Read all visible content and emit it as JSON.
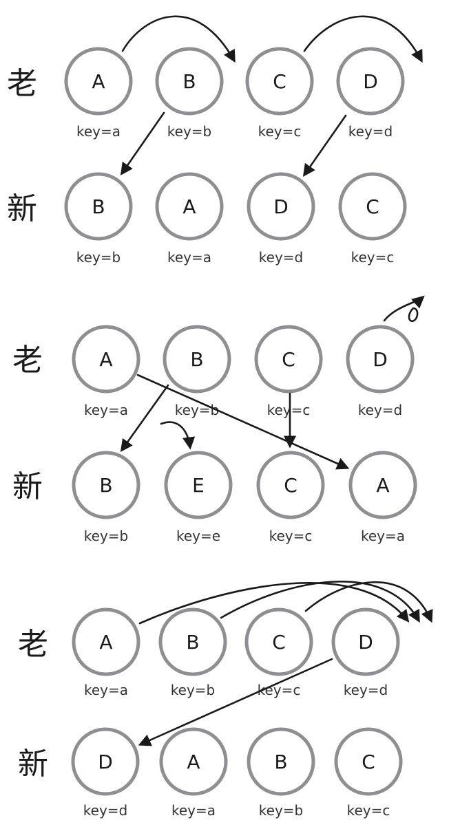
{
  "diagrams": [
    {
      "old_label": "老",
      "new_label": "新",
      "old": [
        {
          "letter": "A",
          "key": "key=a"
        },
        {
          "letter": "B",
          "key": "key=b"
        },
        {
          "letter": "C",
          "key": "key=c"
        },
        {
          "letter": "D",
          "key": "key=d"
        }
      ],
      "new": [
        {
          "letter": "B",
          "key": "key=b"
        },
        {
          "letter": "A",
          "key": "key=a"
        },
        {
          "letter": "D",
          "key": "key=d"
        },
        {
          "letter": "C",
          "key": "key=c"
        }
      ]
    },
    {
      "old_label": "老",
      "new_label": "新",
      "old": [
        {
          "letter": "A",
          "key": "key=a"
        },
        {
          "letter": "B",
          "key": "key=b"
        },
        {
          "letter": "C",
          "key": "key=c"
        },
        {
          "letter": "D",
          "key": "key=d"
        }
      ],
      "new": [
        {
          "letter": "B",
          "key": "key=b"
        },
        {
          "letter": "E",
          "key": "key=e"
        },
        {
          "letter": "C",
          "key": "key=c"
        },
        {
          "letter": "A",
          "key": "key=a"
        }
      ]
    },
    {
      "old_label": "老",
      "new_label": "新",
      "old": [
        {
          "letter": "A",
          "key": "key=a"
        },
        {
          "letter": "B",
          "key": "key=b"
        },
        {
          "letter": "C",
          "key": "key=c"
        },
        {
          "letter": "D",
          "key": "key=d"
        }
      ],
      "new": [
        {
          "letter": "D",
          "key": "key=d"
        },
        {
          "letter": "A",
          "key": "key=a"
        },
        {
          "letter": "B",
          "key": "key=b"
        },
        {
          "letter": "C",
          "key": "key=c"
        }
      ]
    }
  ]
}
